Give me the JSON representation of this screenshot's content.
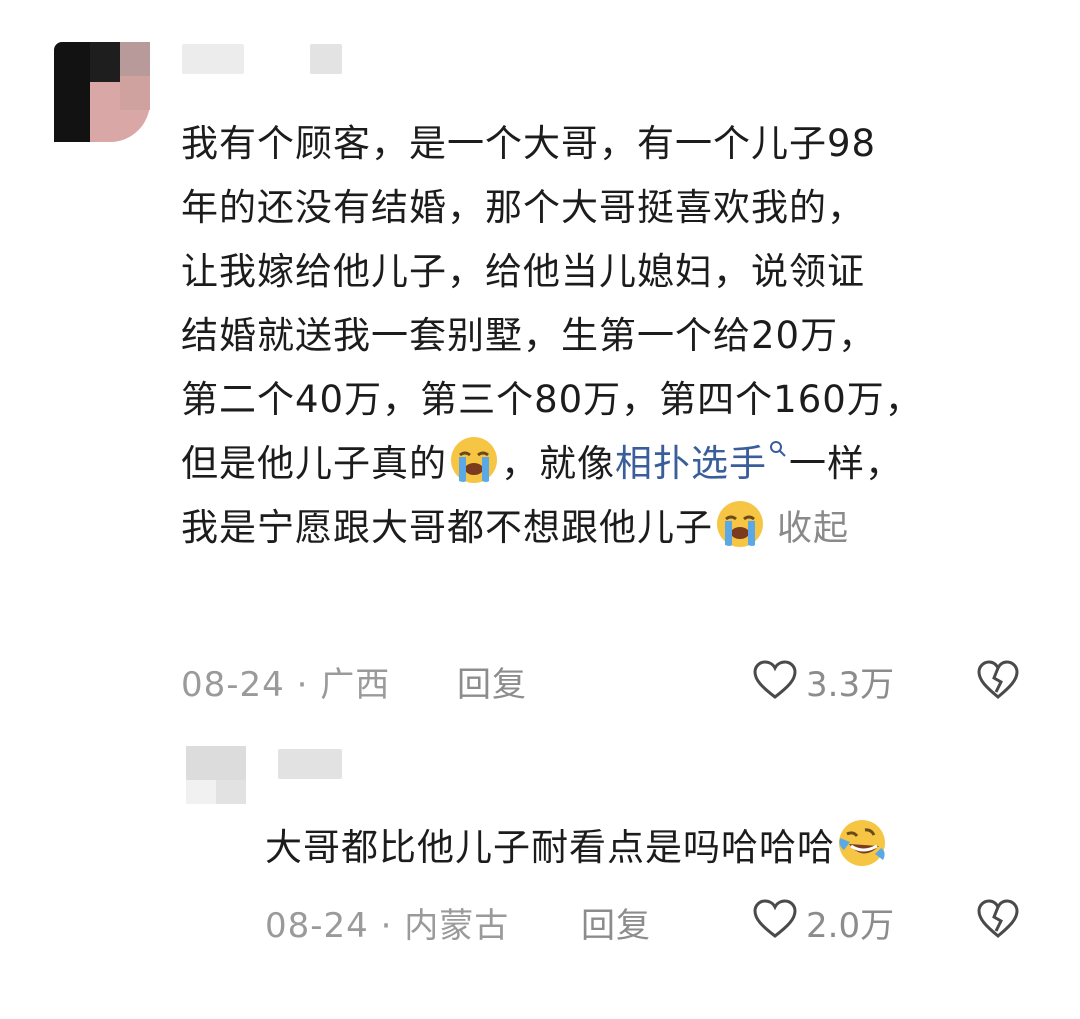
{
  "comment": {
    "lines": [
      "我有个顾客，是一个大哥，有一个儿子98",
      "年的还没有结婚，那个大哥挺喜欢我的，",
      "让我嫁给他儿子，给他当儿媳妇，说领证",
      "结婚就送我一套别墅，生第一个给20万，",
      "第二个40万，第三个80万，第四个160万，"
    ],
    "line6_before": "但是他儿子真的",
    "line6_middle": "，就像",
    "line6_link": "相扑选手",
    "line6_after": "一样，",
    "line7_text": "我是宁愿跟大哥都不想跟他儿子",
    "collapse_label": "收起",
    "meta": "08-24 · 广西",
    "reply_label": "回复",
    "like_count": "3.3万"
  },
  "reply_comment": {
    "text": "大哥都比他儿子耐看点是吗哈哈哈",
    "meta": "08-24 · 内蒙古",
    "reply_label": "回复",
    "like_count": "2.0万"
  },
  "icons": {
    "crying": "loudly-crying-emoji",
    "laughing": "rolling-laughing-emoji",
    "like": "heart-outline-icon",
    "dislike": "broken-heart-icon",
    "search": "search-icon"
  },
  "colors": {
    "link": "#3a5e9a",
    "meta": "#9a9a9a",
    "emoji_yellow": "#f6c544",
    "tears": "#5aa9e6"
  }
}
